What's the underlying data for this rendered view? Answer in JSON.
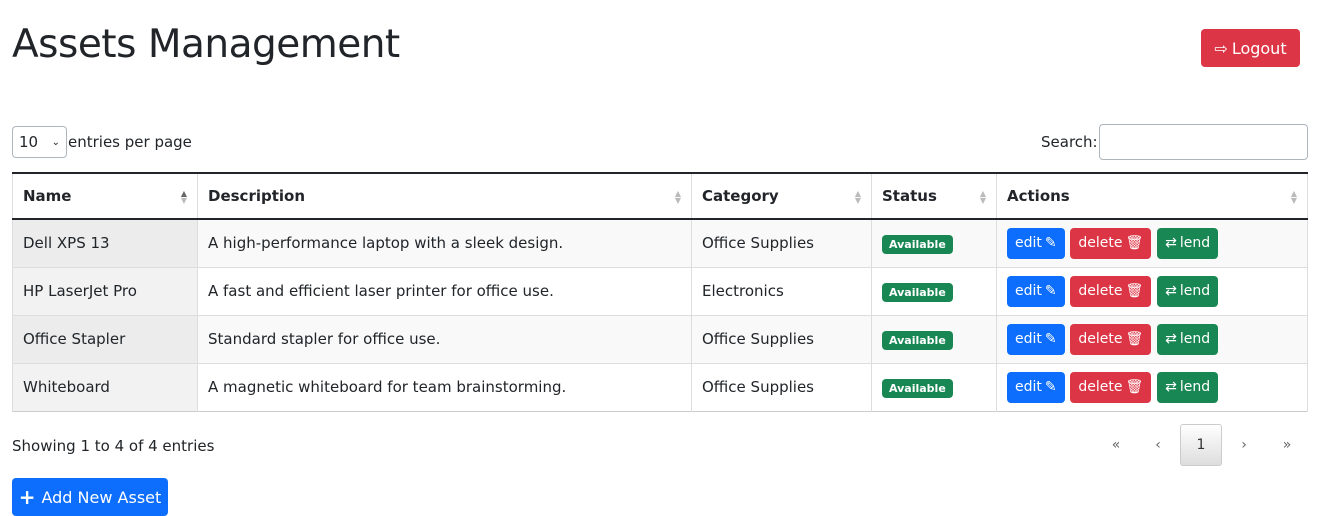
{
  "title": "Assets Management",
  "logout_label": "Logout",
  "length": {
    "value": "10",
    "label": "entries per page"
  },
  "search": {
    "label": "Search:",
    "value": ""
  },
  "columns": [
    "Name",
    "Description",
    "Category",
    "Status",
    "Actions"
  ],
  "rows": [
    {
      "name": "Dell XPS 13",
      "description": "A high-performance laptop with a sleek design.",
      "category": "Office Supplies",
      "status": "Available"
    },
    {
      "name": "HP LaserJet Pro",
      "description": "A fast and efficient laser printer for office use.",
      "category": "Electronics",
      "status": "Available"
    },
    {
      "name": "Office Stapler",
      "description": "Standard stapler for office use.",
      "category": "Office Supplies",
      "status": "Available"
    },
    {
      "name": "Whiteboard",
      "description": "A magnetic whiteboard for team brainstorming.",
      "category": "Office Supplies",
      "status": "Available"
    }
  ],
  "actions": {
    "edit": "edit",
    "delete": "delete",
    "lend": "lend"
  },
  "info": "Showing 1 to 4 of 4 entries",
  "pagination": {
    "first": "«",
    "prev": "‹",
    "current": "1",
    "next": "›",
    "last": "»"
  },
  "add_label": "Add New Asset"
}
